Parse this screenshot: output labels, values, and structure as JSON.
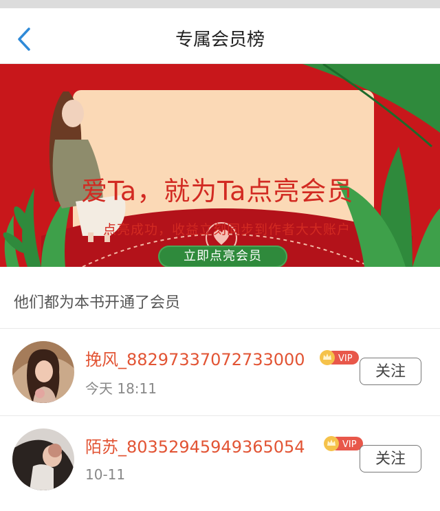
{
  "header": {
    "title": "专属会员榜",
    "back_icon": "chevron-left-icon"
  },
  "banner": {
    "headline": "爱Ta，就为Ta点亮会员",
    "subtitle": "点亮成功，收益立刻同步到作者大大账户",
    "cta_label": "立即点亮会员",
    "colors": {
      "background": "#c8171b",
      "card": "#fbd9b6",
      "headline": "#d22a22",
      "cta": "#2f8a3c",
      "leaf": "#2f8a3c"
    }
  },
  "section": {
    "title": "他们都为本书开通了会员"
  },
  "members": [
    {
      "name": "挽风_88297337072733000",
      "time": "今天 18:11",
      "badge": "VIP",
      "follow_label": "关注"
    },
    {
      "name": "陌苏_80352945949365054",
      "time": "10-11",
      "badge": "VIP",
      "follow_label": "关注"
    }
  ]
}
